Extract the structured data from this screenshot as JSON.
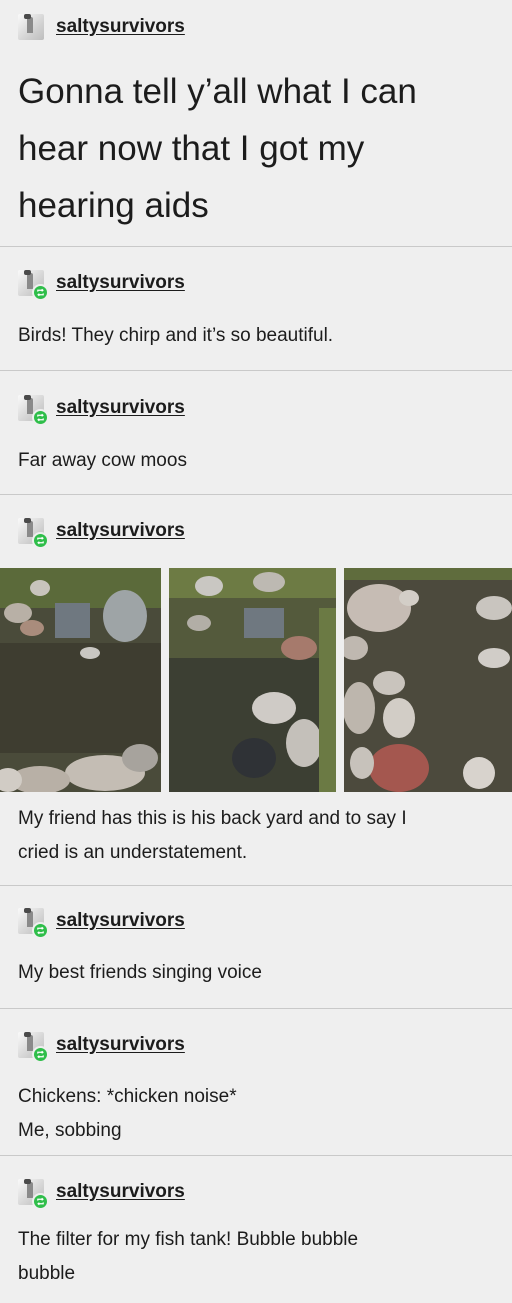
{
  "posts": [
    {
      "username": "saltysurvivors",
      "text_lines": [
        "Gonna tell y’all what I can",
        "hear now that I got my",
        "hearing aids"
      ]
    },
    {
      "username": "saltysurvivors",
      "text_lines": [
        "Birds! They chirp and it’s so beautiful."
      ]
    },
    {
      "username": "saltysurvivors",
      "text_lines": [
        "Far away cow moos"
      ]
    },
    {
      "username": "saltysurvivors",
      "text_lines": [
        "My friend has this is his back yard and to say I",
        "cried is an understatement."
      ]
    },
    {
      "username": "saltysurvivors",
      "text_lines": [
        "My best friends singing voice"
      ]
    },
    {
      "username": "saltysurvivors",
      "text_lines": [
        "Chickens: *chicken noise*",
        "Me, sobbing"
      ]
    },
    {
      "username": "saltysurvivors",
      "text_lines": [
        "The filter for my fish tank! Bubble bubble",
        "bubble"
      ]
    }
  ],
  "icons": {
    "avatar": "avatar-image",
    "reblog": "reblog-icon"
  },
  "colors": {
    "reblog_green": "#2fbe4a",
    "background": "#efefef",
    "divider": "#c9c9c9"
  }
}
